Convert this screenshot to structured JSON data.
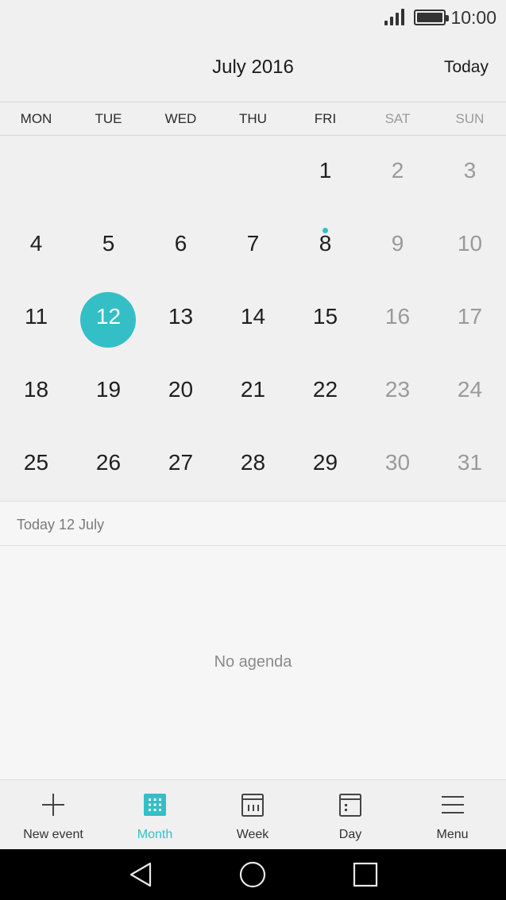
{
  "status_bar": {
    "time": "10:00"
  },
  "header": {
    "title": "July 2016",
    "today_button": "Today"
  },
  "weekdays": [
    "MON",
    "TUE",
    "WED",
    "THU",
    "FRI",
    "SAT",
    "SUN"
  ],
  "calendar": {
    "weeks": [
      [
        "",
        "",
        "",
        "",
        "1",
        "2",
        "3"
      ],
      [
        "4",
        "5",
        "6",
        "7",
        "8",
        "9",
        "10"
      ],
      [
        "11",
        "12",
        "13",
        "14",
        "15",
        "16",
        "17"
      ],
      [
        "18",
        "19",
        "20",
        "21",
        "22",
        "23",
        "24"
      ],
      [
        "25",
        "26",
        "27",
        "28",
        "29",
        "30",
        "31"
      ]
    ],
    "selected_day": "12",
    "days_with_events": [
      "8"
    ]
  },
  "agenda": {
    "date_label": "Today  12 July",
    "empty_text": "No agenda"
  },
  "bottom_tabs": [
    {
      "label": "New event",
      "icon": "plus-icon",
      "active": false
    },
    {
      "label": "Month",
      "icon": "month-grid-icon",
      "active": true
    },
    {
      "label": "Week",
      "icon": "week-calendar-icon",
      "active": false
    },
    {
      "label": "Day",
      "icon": "day-calendar-icon",
      "active": false
    },
    {
      "label": "Menu",
      "icon": "menu-icon",
      "active": false
    }
  ],
  "colors": {
    "accent": "#34bfc6",
    "weekend_text": "#9a9a9a"
  }
}
